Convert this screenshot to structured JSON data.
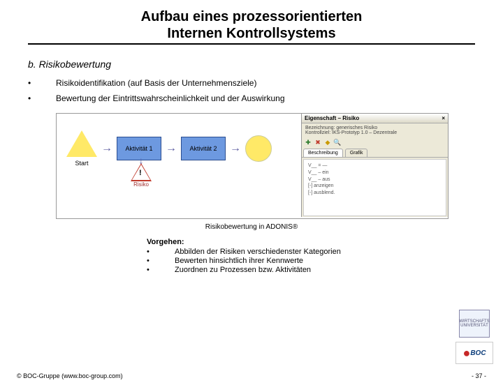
{
  "title_line1": "Aufbau eines prozessorientierten",
  "title_line2": "Internen Kontrollsystems",
  "section": "b. Risikobewertung",
  "bullets": [
    "Risikoidentifikation (auf Basis der Unternehmensziele)",
    "Bewertung der Eintrittswahrscheinlichkeit und der Auswirkung"
  ],
  "flow": {
    "start": "Start",
    "act1": "Aktivität 1",
    "act2": "Aktivität 2",
    "risk": "Risiko"
  },
  "panel": {
    "title": "Eigenschaft – Risiko",
    "info_line1": "Bezeichnung: generisches Risiko",
    "info_line2": "Kontrollziel: IKS-Prototyp 1.0 – Dezentrale",
    "tab1": "Beschreibung",
    "tab2": "Grafik",
    "body1": "V__ = —",
    "body2": "V__ – ein",
    "body3": "V__ – aus",
    "body4": "[-] anzeigen",
    "body5": "[-] ausblend."
  },
  "caption": "Risikobewertung in ADONIS®",
  "vorgehen": {
    "heading": "Vorgehen:",
    "items": [
      "Abbilden der Risiken verschiedenster Kategorien",
      "Bewerten hinsichtlich ihrer Kennwerte",
      "Zuordnen zu Prozessen bzw. Aktivitäten"
    ]
  },
  "footer_left": "© BOC-Gruppe (www.boc-group.com)",
  "footer_right": "- 37 -",
  "logos": {
    "uni": "WIRTSCHAFTS UNIVERSITÄT",
    "boc": "BOC"
  }
}
